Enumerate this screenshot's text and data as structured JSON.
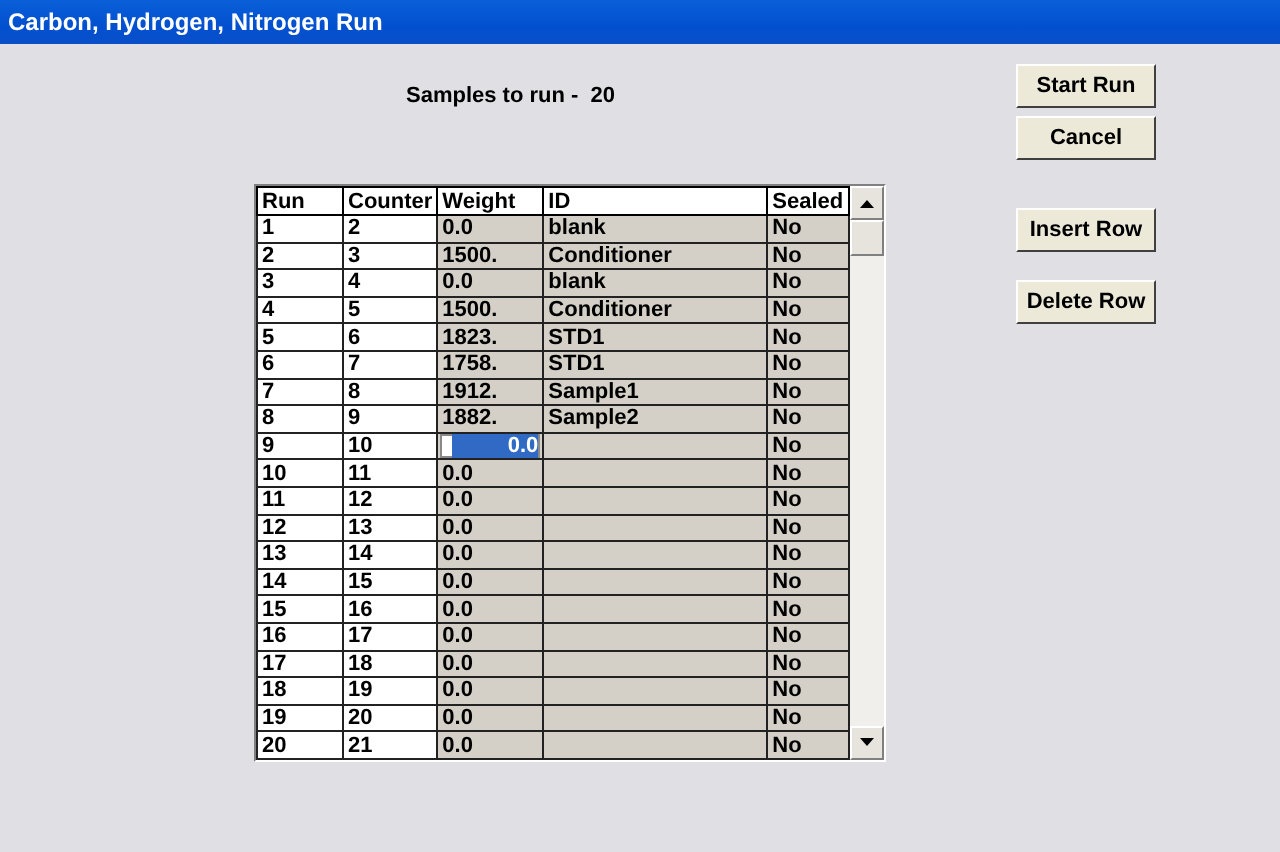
{
  "window": {
    "title": "Carbon, Hydrogen, Nitrogen Run"
  },
  "summary": "Samples to run -  20",
  "table": {
    "columns": [
      "Run",
      "Counter",
      "Weight",
      "ID",
      "Sealed"
    ],
    "rows": [
      {
        "cells": [
          "1",
          "2",
          "0.0",
          "blank",
          "No"
        ],
        "editing": false
      },
      {
        "cells": [
          "2",
          "3",
          "1500.",
          "Conditioner",
          "No"
        ],
        "editing": false
      },
      {
        "cells": [
          "3",
          "4",
          "0.0",
          "blank",
          "No"
        ],
        "editing": false
      },
      {
        "cells": [
          "4",
          "5",
          "1500.",
          "Conditioner",
          "No"
        ],
        "editing": false
      },
      {
        "cells": [
          "5",
          "6",
          "1823.",
          "STD1",
          "No"
        ],
        "editing": false
      },
      {
        "cells": [
          "6",
          "7",
          "1758.",
          "STD1",
          "No"
        ],
        "editing": false
      },
      {
        "cells": [
          "7",
          "8",
          "1912.",
          "Sample1",
          "No"
        ],
        "editing": false
      },
      {
        "cells": [
          "8",
          "9",
          "1882.",
          "Sample2",
          "No"
        ],
        "editing": false
      },
      {
        "cells": [
          "9",
          "10",
          "0.0",
          "",
          "No"
        ],
        "editing": true
      },
      {
        "cells": [
          "10",
          "11",
          "0.0",
          "",
          "No"
        ],
        "editing": false
      },
      {
        "cells": [
          "11",
          "12",
          "0.0",
          "",
          "No"
        ],
        "editing": false
      },
      {
        "cells": [
          "12",
          "13",
          "0.0",
          "",
          "No"
        ],
        "editing": false
      },
      {
        "cells": [
          "13",
          "14",
          "0.0",
          "",
          "No"
        ],
        "editing": false
      },
      {
        "cells": [
          "14",
          "15",
          "0.0",
          "",
          "No"
        ],
        "editing": false
      },
      {
        "cells": [
          "15",
          "16",
          "0.0",
          "",
          "No"
        ],
        "editing": false
      },
      {
        "cells": [
          "16",
          "17",
          "0.0",
          "",
          "No"
        ],
        "editing": false
      },
      {
        "cells": [
          "17",
          "18",
          "0.0",
          "",
          "No"
        ],
        "editing": false
      },
      {
        "cells": [
          "18",
          "19",
          "0.0",
          "",
          "No"
        ],
        "editing": false
      },
      {
        "cells": [
          "19",
          "20",
          "0.0",
          "",
          "No"
        ],
        "editing": false
      },
      {
        "cells": [
          "20",
          "21",
          "0.0",
          "",
          "No"
        ],
        "editing": false
      }
    ]
  },
  "buttons_top": [
    "Start Run",
    "Cancel"
  ],
  "buttons_rows": [
    "Insert Row",
    "Delete Row"
  ]
}
